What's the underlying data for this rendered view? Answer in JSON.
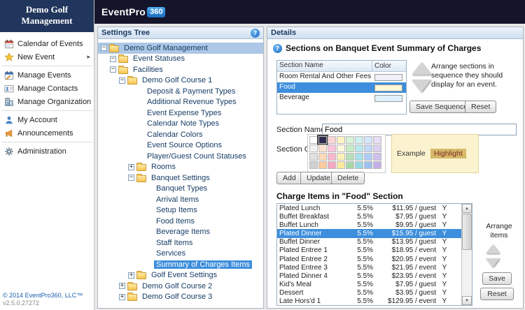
{
  "app": {
    "sidebar_title": "Demo Golf Management",
    "logo": {
      "part1": "Event",
      "part2": "Pro",
      "part3": "360"
    },
    "copyright": "© 2014 EventPro360, LLC™",
    "version": "v2.5.0.27272"
  },
  "sidebar": {
    "groups": [
      {
        "items": [
          {
            "label": "Calendar of Events",
            "icon": "calendar-icon",
            "submenu": false
          },
          {
            "label": "New Event",
            "icon": "new-event-icon",
            "submenu": true
          }
        ]
      },
      {
        "items": [
          {
            "label": "Manage Events",
            "icon": "manage-events-icon",
            "submenu": false
          },
          {
            "label": "Manage Contacts",
            "icon": "manage-contacts-icon",
            "submenu": false
          },
          {
            "label": "Manage Organizations",
            "icon": "manage-organizations-icon",
            "submenu": false
          }
        ]
      },
      {
        "items": [
          {
            "label": "My Account",
            "icon": "my-account-icon",
            "submenu": false
          },
          {
            "label": "Announcements",
            "icon": "announcements-icon",
            "submenu": false
          }
        ]
      },
      {
        "items": [
          {
            "label": "Administration",
            "icon": "administration-icon",
            "submenu": false
          }
        ]
      }
    ]
  },
  "settings_tree": {
    "header": "Settings Tree",
    "nodes": [
      {
        "label": "Demo Golf Management",
        "depth": 0,
        "folder": true,
        "toggle": "minus",
        "state": "selected-inactive"
      },
      {
        "label": "Event Statuses",
        "depth": 1,
        "folder": true,
        "toggle": "minus",
        "state": null
      },
      {
        "label": "Facilities",
        "depth": 1,
        "folder": true,
        "toggle": "minus",
        "state": null
      },
      {
        "label": "Demo Golf Course 1",
        "depth": 2,
        "folder": true,
        "toggle": "minus",
        "state": null
      },
      {
        "label": "Deposit & Payment Types",
        "depth": 3,
        "folder": false,
        "toggle": null,
        "state": null
      },
      {
        "label": "Additional Revenue Types",
        "depth": 3,
        "folder": false,
        "toggle": null,
        "state": null
      },
      {
        "label": "Event Expense Types",
        "depth": 3,
        "folder": false,
        "toggle": null,
        "state": null
      },
      {
        "label": "Calendar Note Types",
        "depth": 3,
        "folder": false,
        "toggle": null,
        "state": null
      },
      {
        "label": "Calendar Colors",
        "depth": 3,
        "folder": false,
        "toggle": null,
        "state": null
      },
      {
        "label": "Event Source Options",
        "depth": 3,
        "folder": false,
        "toggle": null,
        "state": null
      },
      {
        "label": "Player/Guest Count Statuses",
        "depth": 3,
        "folder": false,
        "toggle": null,
        "state": null
      },
      {
        "label": "Rooms",
        "depth": 3,
        "folder": true,
        "toggle": "plus",
        "state": null
      },
      {
        "label": "Banquet Settings",
        "depth": 3,
        "folder": true,
        "toggle": "minus",
        "state": null
      },
      {
        "label": "Banquet Types",
        "depth": 4,
        "folder": false,
        "toggle": null,
        "state": null
      },
      {
        "label": "Arrival Items",
        "depth": 4,
        "folder": false,
        "toggle": null,
        "state": null
      },
      {
        "label": "Setup Items",
        "depth": 4,
        "folder": false,
        "toggle": null,
        "state": null
      },
      {
        "label": "Food Items",
        "depth": 4,
        "folder": false,
        "toggle": null,
        "state": null
      },
      {
        "label": "Beverage Items",
        "depth": 4,
        "folder": false,
        "toggle": null,
        "state": null
      },
      {
        "label": "Staff Items",
        "depth": 4,
        "folder": false,
        "toggle": null,
        "state": null
      },
      {
        "label": "Services",
        "depth": 4,
        "folder": false,
        "toggle": null,
        "state": null
      },
      {
        "label": "Summary of Charges Items",
        "depth": 4,
        "folder": false,
        "toggle": null,
        "state": "selected"
      },
      {
        "label": "Golf Event Settings",
        "depth": 3,
        "folder": true,
        "toggle": "plus",
        "state": null
      },
      {
        "label": "Demo Golf Course 2",
        "depth": 2,
        "folder": true,
        "toggle": "plus",
        "state": null
      },
      {
        "label": "Demo Golf Course 3",
        "depth": 2,
        "folder": true,
        "toggle": "plus",
        "state": null
      }
    ]
  },
  "details": {
    "header": "Details",
    "section_title": "Sections on Banquet Event Summary of Charges",
    "sections_table": {
      "columns": [
        "Section Name",
        "Color"
      ],
      "rows": [
        {
          "name": "Room Rental And Other Fees",
          "color": "#f0effa",
          "selected": false
        },
        {
          "name": "Food",
          "color": "#fdf7d8",
          "selected": true
        },
        {
          "name": "Beverage",
          "color": "#dff0fa",
          "selected": false
        }
      ]
    },
    "arrange_sections_note": "Arrange sections in sequence they should display for an event.",
    "save_sequence_label": "Save Sequence",
    "reset_label": "Reset",
    "section_name_label": "Section Name",
    "section_name_value": "Food",
    "section_color_label": "Section Color",
    "palette": {
      "rows": [
        [
          "#ffffff",
          "#2b2b4e",
          "#fbd5d5",
          "#fdf3c4",
          "#d8f3d8",
          "#cdf0f0",
          "#d5e5fb",
          "#e6ddf6"
        ],
        [
          "#f2f2f2",
          "#fde2cf",
          "#fbc4dd",
          "#fdf8dc",
          "#c4edc4",
          "#b8e8f0",
          "#c4d8f8",
          "#dcd0f0"
        ],
        [
          "#e0e0e0",
          "#fcd9b8",
          "#f8b8cc",
          "#fbf0b8",
          "#b8e0b8",
          "#a8e0ea",
          "#b0cdf5",
          "#d0c0ec"
        ],
        [
          "#d0d0d0",
          "#fbcba0",
          "#f5a8c0",
          "#f8ea9f",
          "#a8d8a8",
          "#98d8e4",
          "#9cc0f0",
          "#c4b0e8"
        ]
      ],
      "selected_cell": [
        0,
        1
      ]
    },
    "example_label": "Example",
    "highlight_label": "Highlight",
    "add_label": "Add",
    "update_label": "Update",
    "delete_label": "Delete",
    "charge_title": "Charge Items in \"Food\" Section",
    "charge_items": [
      {
        "name": "Plated Lunch",
        "tax": "5.5%",
        "price": "$11.95 / guest",
        "flag": "Y",
        "selected": false
      },
      {
        "name": "Buffet Breakfast",
        "tax": "5.5%",
        "price": "$7.95 / guest",
        "flag": "Y",
        "selected": false
      },
      {
        "name": "Buffet Lunch",
        "tax": "5.5%",
        "price": "$9.95 / guest",
        "flag": "Y",
        "selected": false
      },
      {
        "name": "Plated Dinner",
        "tax": "5.5%",
        "price": "$15.95 / guest",
        "flag": "Y",
        "selected": true
      },
      {
        "name": "Buffet Dinner",
        "tax": "5.5%",
        "price": "$13.95 / guest",
        "flag": "Y",
        "selected": false
      },
      {
        "name": "Plated Entree 1",
        "tax": "5.5%",
        "price": "$18.95 / event",
        "flag": "Y",
        "selected": false
      },
      {
        "name": "Plated Entree 2",
        "tax": "5.5%",
        "price": "$20.95 / event",
        "flag": "Y",
        "selected": false
      },
      {
        "name": "Plated Entree 3",
        "tax": "5.5%",
        "price": "$21.95 / event",
        "flag": "Y",
        "selected": false
      },
      {
        "name": "Plated Dinner 4",
        "tax": "5.5%",
        "price": "$23.95 / event",
        "flag": "Y",
        "selected": false
      },
      {
        "name": "Kid's Meal",
        "tax": "5.5%",
        "price": "$7.95 / guest",
        "flag": "Y",
        "selected": false
      },
      {
        "name": "Dessert",
        "tax": "5.5%",
        "price": "$3.95 / guest",
        "flag": "Y",
        "selected": false
      },
      {
        "name": "Late Hors'd 1",
        "tax": "5.5%",
        "price": "$129.95 / event",
        "flag": "Y",
        "selected": false
      }
    ],
    "arrange_items_note": "Arrange items",
    "save_label": "Save"
  }
}
